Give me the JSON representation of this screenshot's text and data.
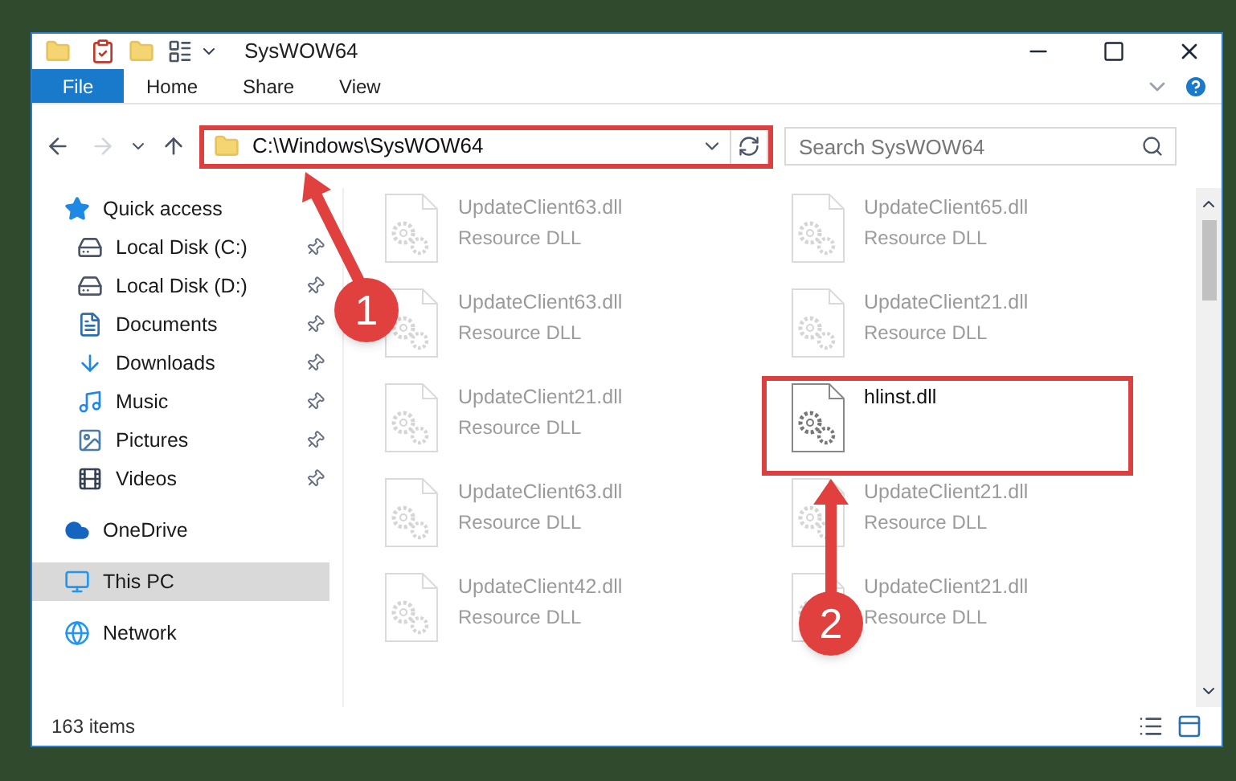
{
  "window": {
    "title": "SysWOW64"
  },
  "ribbon_tabs": [
    {
      "label": "File",
      "kind": "file"
    },
    {
      "label": "Home",
      "kind": "tab"
    },
    {
      "label": "Share",
      "kind": "tab"
    },
    {
      "label": "View",
      "kind": "tab"
    }
  ],
  "address_bar": {
    "path": "C:\\Windows\\SysWOW64"
  },
  "search": {
    "placeholder": "Search SysWOW64"
  },
  "navigation": [
    {
      "label": "Quick access",
      "kind": "star",
      "selected": false,
      "children": [
        {
          "label": "Local Disk (C:)",
          "kind": "drive",
          "pinned": true
        },
        {
          "label": "Local Disk (D:)",
          "kind": "drive",
          "pinned": true
        },
        {
          "label": "Documents",
          "kind": "documents",
          "pinned": true
        },
        {
          "label": "Downloads",
          "kind": "downloads",
          "pinned": true
        },
        {
          "label": "Music",
          "kind": "music",
          "pinned": true
        },
        {
          "label": "Pictures",
          "kind": "pictures",
          "pinned": true
        },
        {
          "label": "Videos",
          "kind": "videos",
          "pinned": true
        }
      ]
    },
    {
      "label": "OneDrive",
      "kind": "cloud",
      "selected": false
    },
    {
      "label": "This PC",
      "kind": "pc",
      "selected": true
    },
    {
      "label": "Network",
      "kind": "network",
      "selected": false
    }
  ],
  "files": [
    {
      "name": "UpdateClient63.dll",
      "type": "Resource DLL",
      "dimmed": true
    },
    {
      "name": "UpdateClient65.dll",
      "type": "Resource DLL",
      "dimmed": true
    },
    {
      "name": "UpdateClient63.dll",
      "type": "Resource DLL",
      "dimmed": true
    },
    {
      "name": "UpdateClient21.dll",
      "type": "Resource DLL",
      "dimmed": true
    },
    {
      "name": "UpdateClient21.dll",
      "type": "Resource DLL",
      "dimmed": true
    },
    {
      "name": "hlinst.dll",
      "dimmed": false
    },
    {
      "name": "UpdateClient63.dll",
      "type": "Resource DLL",
      "dimmed": true
    },
    {
      "name": "UpdateClient21.dll",
      "type": "Resource DLL",
      "dimmed": true
    },
    {
      "name": "UpdateClient42.dll",
      "type": "Resource DLL",
      "dimmed": true
    },
    {
      "name": "UpdateClient21.dll",
      "type": "Resource DLL",
      "dimmed": true
    }
  ],
  "status_bar": {
    "item_count": "163 items"
  },
  "annotations": [
    {
      "number": "1"
    },
    {
      "number": "2"
    }
  ]
}
